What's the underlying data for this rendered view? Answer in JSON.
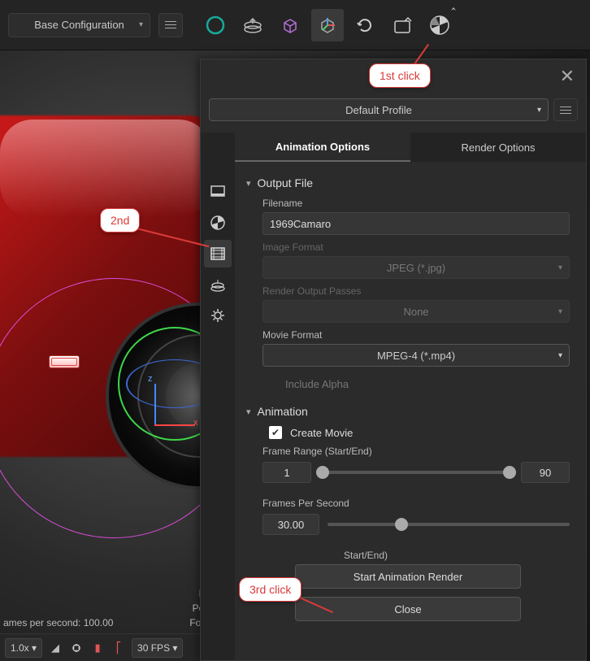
{
  "toolbar": {
    "config_label": "Base Configuration"
  },
  "panel": {
    "profile_label": "Default Profile",
    "tabs": {
      "animation": "Animation Options",
      "render": "Render Options"
    },
    "sections": {
      "output_file": "Output File",
      "animation": "Animation"
    },
    "fields": {
      "filename_label": "Filename",
      "filename_value": "1969Camaro",
      "image_format_label": "Image Format",
      "image_format_value": "JPEG (*.jpg)",
      "render_passes_label": "Render Output Passes",
      "render_passes_value": "None",
      "movie_format_label": "Movie Format",
      "movie_format_value": "MPEG-4 (*.mp4)",
      "include_alpha": "Include Alpha",
      "create_movie": "Create Movie",
      "frame_range_label": "Frame Range (Start/End)",
      "frame_start": "1",
      "frame_end": "90",
      "fps_label": "Frames Per Second",
      "fps_value": "30.00",
      "animation_range_label": "Start/End)"
    },
    "buttons": {
      "start_render": "Start Animation Render",
      "close": "Close"
    }
  },
  "status": {
    "fps": "ames per second: 100.00",
    "re": "Re",
    "poly": "Poly",
    "foca": "Foca"
  },
  "timeline": {
    "zoom": "1.0x",
    "fps": "30 FPS"
  },
  "callouts": {
    "first": "1st click",
    "second": "2nd",
    "third": "3rd click"
  },
  "gizmo": {
    "x": "x",
    "z": "z"
  }
}
